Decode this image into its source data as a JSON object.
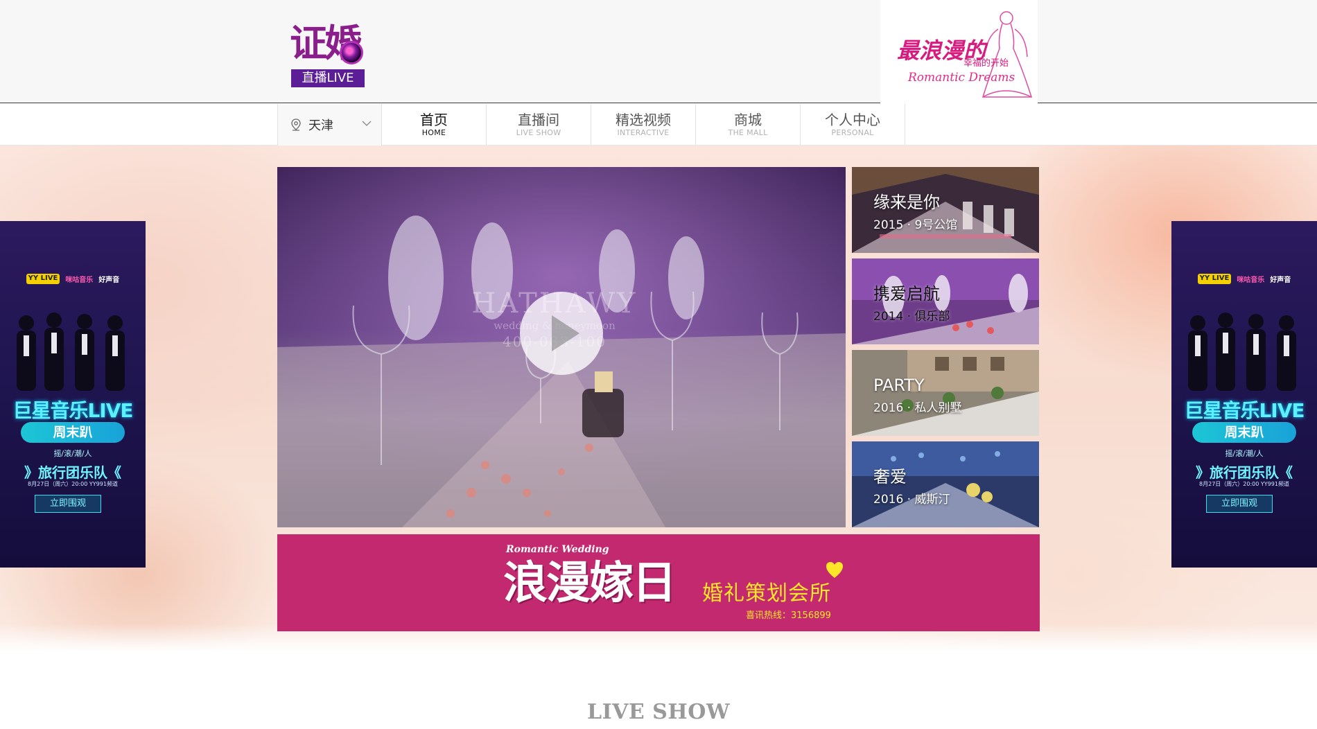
{
  "header": {
    "logo_text": "证婚",
    "logo_badge": "直播LIVE",
    "romantic_title": "最浪漫的",
    "romantic_sub": "幸福的开始",
    "romantic_en": "Romantic Dreams"
  },
  "nav": {
    "city": "天津",
    "items": [
      {
        "cn": "首页",
        "en": "HOME"
      },
      {
        "cn": "直播间",
        "en": "LIVE SHOW"
      },
      {
        "cn": "精选视频",
        "en": "INTERACTIVE"
      },
      {
        "cn": "商城",
        "en": "THE MALL"
      },
      {
        "cn": "个人中心",
        "en": "PERSONAL"
      }
    ]
  },
  "side_banner": {
    "logos": [
      "YY LIVE",
      "咪咕音乐",
      "好声音"
    ],
    "title": "巨星音乐LIVE",
    "subtitle": "周末趴",
    "tagline": "摇/滚/潮/人",
    "band": "》旅行团乐队《",
    "date": "8月27日（周六）20:00 YY991频道",
    "button": "立即围观"
  },
  "video": {
    "brand": "HATHAWY",
    "brand_sub": "wedding & honeymoon",
    "brand_phone": "400-083-100"
  },
  "thumbnails": [
    {
      "title": "缘来是你",
      "subtitle": "2015 · 9号公馆"
    },
    {
      "title": "携爱启航",
      "subtitle": "2014 · 俱乐部"
    },
    {
      "title": "PARTY",
      "subtitle": "2016 · 私人别墅"
    },
    {
      "title": "奢爱",
      "subtitle": "2016 · 威斯汀"
    }
  ],
  "ad": {
    "en": "Romantic Wedding",
    "big": "浪漫嫁日",
    "club": "婚礼策划会所",
    "hotline": "喜讯热线：3156899"
  },
  "section_title": "LIVE SHOW"
}
